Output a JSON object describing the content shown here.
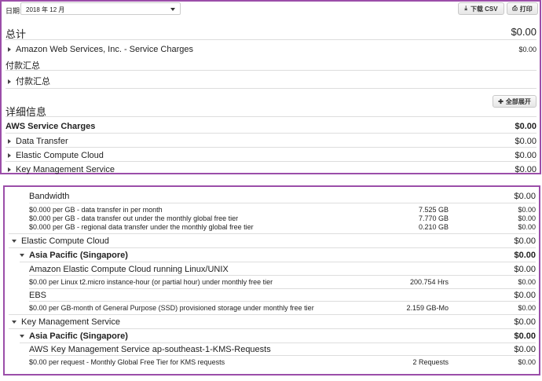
{
  "toolbar": {
    "date_label": "日期:",
    "date_value": "2018 年 12 月",
    "download_csv": "下载 CSV",
    "print": "打印"
  },
  "summary": {
    "title": "总计",
    "total": "$0.00",
    "provider": "Amazon Web Services, Inc. - Service Charges",
    "provider_amount": "$0.00",
    "payment_summary_label": "付款汇总",
    "payment_summary_toggle": "付款汇总"
  },
  "details": {
    "title": "详细信息",
    "expand_all": "全部展开",
    "service_charges": "AWS Service Charges",
    "service_charges_amount": "$0.00",
    "services": [
      {
        "name": "Data Transfer",
        "amount": "$0.00"
      },
      {
        "name": "Elastic Compute Cloud",
        "amount": "$0.00"
      },
      {
        "name": "Key Management Service",
        "amount": "$0.00"
      }
    ]
  },
  "detail_panel": {
    "bandwidth": {
      "label": "Bandwidth",
      "amount": "$0.00"
    },
    "bandwidth_rows": [
      {
        "desc": "$0.000 per GB - data transfer in per month",
        "qty": "7.525 GB",
        "amount": "$0.00"
      },
      {
        "desc": "$0.000 per GB - data transfer out under the monthly global free tier",
        "qty": "7.770 GB",
        "amount": "$0.00"
      },
      {
        "desc": "$0.000 per GB - regional data transfer under the monthly global free tier",
        "qty": "0.210 GB",
        "amount": "$0.00"
      }
    ],
    "ec2": {
      "label": "Elastic Compute Cloud",
      "amount": "$0.00"
    },
    "ec2_region": {
      "label": "Asia Pacific (Singapore)",
      "amount": "$0.00"
    },
    "ec2_running": {
      "label": "Amazon Elastic Compute Cloud running Linux/UNIX",
      "amount": "$0.00"
    },
    "ec2_running_row": {
      "desc": "$0.00 per Linux t2.micro instance-hour (or partial hour) under monthly free tier",
      "qty": "200.754 Hrs",
      "amount": "$0.00"
    },
    "ebs": {
      "label": "EBS",
      "amount": "$0.00"
    },
    "ebs_row": {
      "desc": "$0.00 per GB-month of General Purpose (SSD) provisioned storage under monthly free tier",
      "qty": "2.159 GB-Mo",
      "amount": "$0.00"
    },
    "kms": {
      "label": "Key Management Service",
      "amount": "$0.00"
    },
    "kms_region": {
      "label": "Asia Pacific (Singapore)",
      "amount": "$0.00"
    },
    "kms_requests": {
      "label": "AWS Key Management Service ap-southeast-1-KMS-Requests",
      "amount": "$0.00"
    },
    "kms_row": {
      "desc": "$0.00 per request - Monthly Global Free Tier for KMS requests",
      "qty": "2 Requests",
      "amount": "$0.00"
    }
  }
}
